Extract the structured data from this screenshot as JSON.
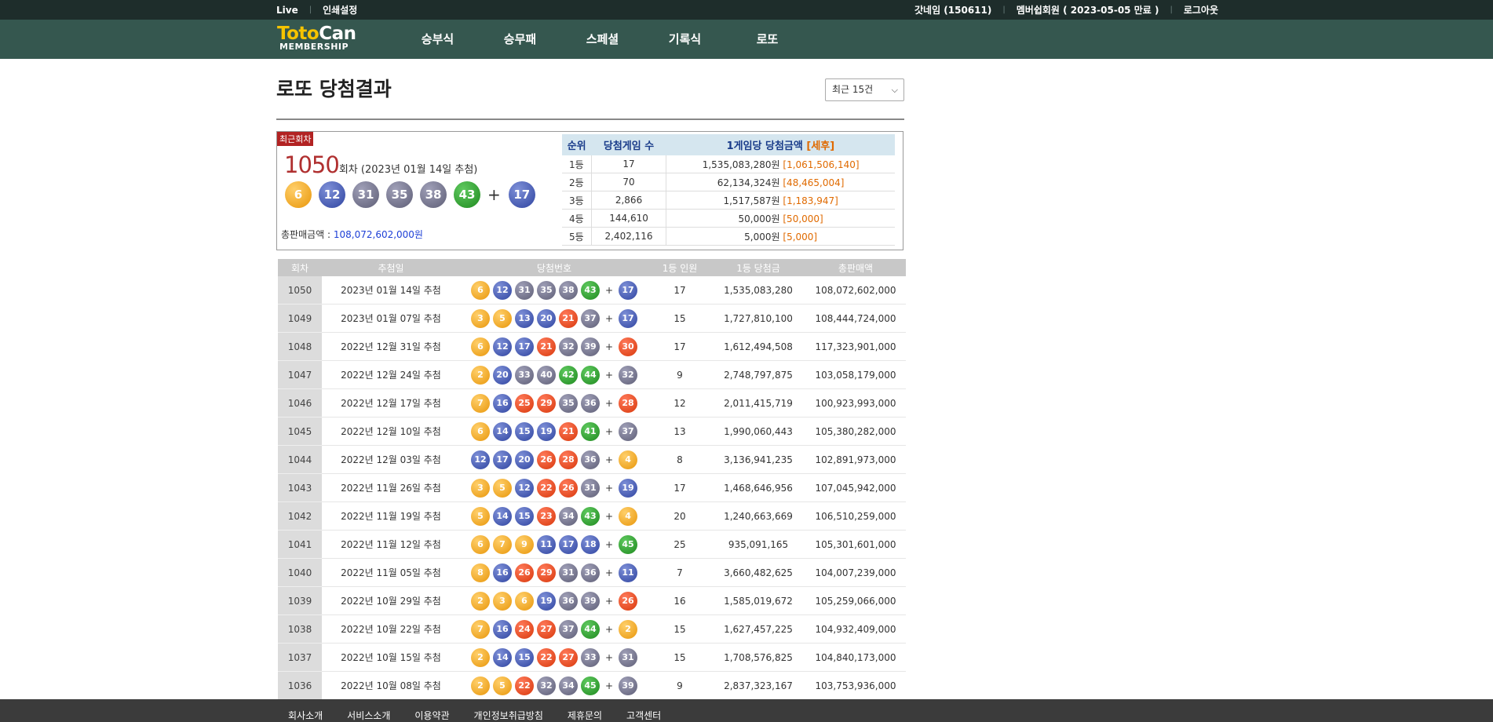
{
  "topbar": {
    "left": [
      "Live",
      "인쇄설정"
    ],
    "right": [
      "갓네임 (150611)",
      "멤버쉽회원 ( 2023-05-05 만료 )",
      "로그아웃"
    ]
  },
  "logo": {
    "line1_a": "Toto",
    "line1_b": "Can",
    "line2": "MEMBERSHIP"
  },
  "nav": [
    "승부식",
    "승무패",
    "스페셜",
    "기록식",
    "로또"
  ],
  "page": {
    "title": "로또 당첨결과",
    "select_value": "최근 15건"
  },
  "latest": {
    "badge": "최근회차",
    "round": "1050",
    "round_suffix": "회차",
    "date": "(2023년 01월 14일 추첨)",
    "numbers": [
      6,
      12,
      31,
      35,
      38,
      43
    ],
    "bonus": 17,
    "sales_label": "총판매금액 : ",
    "sales_value": "108,072,602,000원"
  },
  "prize_table": {
    "headers": [
      "순위",
      "당첨게임 수",
      "1게임당 당첨금액",
      "[세후]"
    ],
    "rows": [
      [
        "1등",
        "17",
        "1,535,083,280원",
        "[1,061,506,140]"
      ],
      [
        "2등",
        "70",
        "62,134,324원",
        "[48,465,004]"
      ],
      [
        "3등",
        "2,866",
        "1,517,587원",
        "[1,183,947]"
      ],
      [
        "4등",
        "144,610",
        "50,000원",
        "[50,000]"
      ],
      [
        "5등",
        "2,402,116",
        "5,000원",
        "[5,000]"
      ]
    ]
  },
  "results_table": {
    "headers": [
      "회차",
      "추첨일",
      "당첨번호",
      "1등 인원",
      "1등 당첨금",
      "총판매액"
    ],
    "rows": [
      {
        "round": "1050",
        "date": "2023년 01월 14일 추첨",
        "nums": [
          6,
          12,
          31,
          35,
          38,
          43
        ],
        "bonus": 17,
        "winners": "17",
        "prize": "1,535,083,280",
        "sales": "108,072,602,000"
      },
      {
        "round": "1049",
        "date": "2023년 01월 07일 추첨",
        "nums": [
          3,
          5,
          13,
          20,
          21,
          37
        ],
        "bonus": 17,
        "winners": "15",
        "prize": "1,727,810,100",
        "sales": "108,444,724,000"
      },
      {
        "round": "1048",
        "date": "2022년 12월 31일 추첨",
        "nums": [
          6,
          12,
          17,
          21,
          32,
          39
        ],
        "bonus": 30,
        "winners": "17",
        "prize": "1,612,494,508",
        "sales": "117,323,901,000"
      },
      {
        "round": "1047",
        "date": "2022년 12월 24일 추첨",
        "nums": [
          2,
          20,
          33,
          40,
          42,
          44
        ],
        "bonus": 32,
        "winners": "9",
        "prize": "2,748,797,875",
        "sales": "103,058,179,000"
      },
      {
        "round": "1046",
        "date": "2022년 12월 17일 추첨",
        "nums": [
          7,
          16,
          25,
          29,
          35,
          36
        ],
        "bonus": 28,
        "winners": "12",
        "prize": "2,011,415,719",
        "sales": "100,923,993,000"
      },
      {
        "round": "1045",
        "date": "2022년 12월 10일 추첨",
        "nums": [
          6,
          14,
          15,
          19,
          21,
          41
        ],
        "bonus": 37,
        "winners": "13",
        "prize": "1,990,060,443",
        "sales": "105,380,282,000"
      },
      {
        "round": "1044",
        "date": "2022년 12월 03일 추첨",
        "nums": [
          12,
          17,
          20,
          26,
          28,
          36
        ],
        "bonus": 4,
        "winners": "8",
        "prize": "3,136,941,235",
        "sales": "102,891,973,000"
      },
      {
        "round": "1043",
        "date": "2022년 11월 26일 추첨",
        "nums": [
          3,
          5,
          12,
          22,
          26,
          31
        ],
        "bonus": 19,
        "winners": "17",
        "prize": "1,468,646,956",
        "sales": "107,045,942,000"
      },
      {
        "round": "1042",
        "date": "2022년 11월 19일 추첨",
        "nums": [
          5,
          14,
          15,
          23,
          34,
          43
        ],
        "bonus": 4,
        "winners": "20",
        "prize": "1,240,663,669",
        "sales": "106,510,259,000"
      },
      {
        "round": "1041",
        "date": "2022년 11월 12일 추첨",
        "nums": [
          6,
          7,
          9,
          11,
          17,
          18
        ],
        "bonus": 45,
        "winners": "25",
        "prize": "935,091,165",
        "sales": "105,301,601,000"
      },
      {
        "round": "1040",
        "date": "2022년 11월 05일 추첨",
        "nums": [
          8,
          16,
          26,
          29,
          31,
          36
        ],
        "bonus": 11,
        "winners": "7",
        "prize": "3,660,482,625",
        "sales": "104,007,239,000"
      },
      {
        "round": "1039",
        "date": "2022년 10월 29일 추첨",
        "nums": [
          2,
          3,
          6,
          19,
          36,
          39
        ],
        "bonus": 26,
        "winners": "16",
        "prize": "1,585,019,672",
        "sales": "105,259,066,000"
      },
      {
        "round": "1038",
        "date": "2022년 10월 22일 추첨",
        "nums": [
          7,
          16,
          24,
          27,
          37,
          44
        ],
        "bonus": 2,
        "winners": "15",
        "prize": "1,627,457,225",
        "sales": "104,932,409,000"
      },
      {
        "round": "1037",
        "date": "2022년 10월 15일 추첨",
        "nums": [
          2,
          14,
          15,
          22,
          27,
          33
        ],
        "bonus": 31,
        "winners": "15",
        "prize": "1,708,576,825",
        "sales": "104,840,173,000"
      },
      {
        "round": "1036",
        "date": "2022년 10월 08일 추첨",
        "nums": [
          2,
          5,
          22,
          32,
          34,
          45
        ],
        "bonus": 39,
        "winners": "9",
        "prize": "2,837,323,167",
        "sales": "103,753,936,000"
      }
    ]
  },
  "footer": [
    "회사소개",
    "서비스소개",
    "이용약관",
    "개인정보취급방침",
    "제휴문의",
    "고객센터"
  ]
}
